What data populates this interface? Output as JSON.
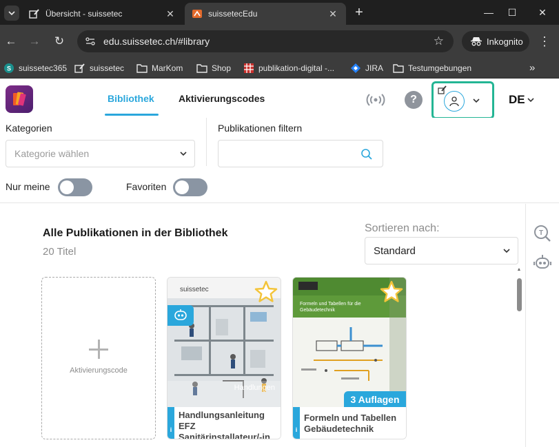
{
  "browser": {
    "tabs": [
      {
        "label": "Übersicht - suissetec",
        "active": false
      },
      {
        "label": "suissetecEdu",
        "active": true
      }
    ],
    "url": "edu.suissetec.ch/#library",
    "incognito_label": "Inkognito",
    "bookmarks": [
      {
        "label": "suissetec365",
        "icon": "sharepoint-icon"
      },
      {
        "label": "suissetec",
        "icon": "edit-page-icon"
      },
      {
        "label": "MarKom",
        "icon": "folder-icon"
      },
      {
        "label": "Shop",
        "icon": "folder-icon"
      },
      {
        "label": "publikation-digital -...",
        "icon": "grid-icon"
      },
      {
        "label": "JIRA",
        "icon": "jira-icon"
      },
      {
        "label": "Testumgebungen",
        "icon": "folder-icon"
      }
    ]
  },
  "app": {
    "nav": {
      "library": "Bibliothek",
      "codes": "Aktivierungscodes"
    },
    "language": "DE",
    "filters": {
      "categories_label": "Kategorien",
      "categories_placeholder": "Kategorie wählen",
      "search_label": "Publikationen filtern",
      "only_mine_label": "Nur meine",
      "favorites_label": "Favoriten"
    },
    "library": {
      "title": "Alle Publikationen in der Bibliothek",
      "count": "20 Titel",
      "sort_label": "Sortieren nach:",
      "sort_value": "Standard",
      "add_card_label": "Aktivierungscode",
      "publications": [
        {
          "title": "Handlungsanleitung EFZ Sanitärinstallateur/-in",
          "cover_brand": "suissetec",
          "cover_caption": "Handlungen",
          "info_icon": "i"
        },
        {
          "title": "Formeln und Tabellen Gebäudetechnik",
          "cover_heading": "Formeln und Tabellen für die Gebäudetechnik",
          "badge": "3 Auflagen",
          "info_icon": "i"
        }
      ]
    }
  },
  "colors": {
    "accent": "#2aa7dc",
    "highlight_border": "#23b594",
    "toggle_off": "#8a95a3",
    "star": "#f3c43a"
  }
}
